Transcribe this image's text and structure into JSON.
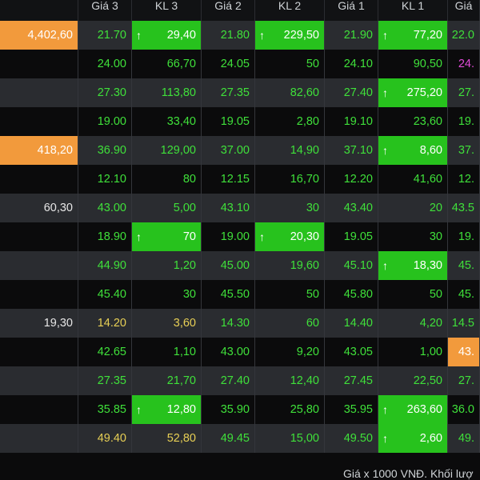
{
  "header": [
    "",
    "Giá 3",
    "KL 3",
    "Giá 2",
    "KL 2",
    "Giá 1",
    "KL 1",
    "Giá"
  ],
  "rows": [
    [
      {
        "t": "4,402,60",
        "c": "orange-bg"
      },
      {
        "t": "21.70",
        "c": "green"
      },
      {
        "t": "29,40",
        "c": "green-bg",
        "up": true
      },
      {
        "t": "21.80",
        "c": "green"
      },
      {
        "t": "229,50",
        "c": "green-bg",
        "up": true
      },
      {
        "t": "21.90",
        "c": "green"
      },
      {
        "t": "77,20",
        "c": "green-bg",
        "up": true
      },
      {
        "t": "22.0",
        "c": "green"
      }
    ],
    [
      {
        "t": "",
        "c": "white"
      },
      {
        "t": "24.00",
        "c": "green"
      },
      {
        "t": "66,70",
        "c": "green"
      },
      {
        "t": "24.05",
        "c": "green"
      },
      {
        "t": "50",
        "c": "green"
      },
      {
        "t": "24.10",
        "c": "green"
      },
      {
        "t": "90,50",
        "c": "green"
      },
      {
        "t": "24.",
        "c": "pink"
      }
    ],
    [
      {
        "t": "",
        "c": "white"
      },
      {
        "t": "27.30",
        "c": "green"
      },
      {
        "t": "113,80",
        "c": "green"
      },
      {
        "t": "27.35",
        "c": "green"
      },
      {
        "t": "82,60",
        "c": "green"
      },
      {
        "t": "27.40",
        "c": "green"
      },
      {
        "t": "275,20",
        "c": "green-bg",
        "up": true
      },
      {
        "t": "27.",
        "c": "green"
      }
    ],
    [
      {
        "t": "",
        "c": "white"
      },
      {
        "t": "19.00",
        "c": "green"
      },
      {
        "t": "33,40",
        "c": "green"
      },
      {
        "t": "19.05",
        "c": "green"
      },
      {
        "t": "2,80",
        "c": "green"
      },
      {
        "t": "19.10",
        "c": "green"
      },
      {
        "t": "23,60",
        "c": "green"
      },
      {
        "t": "19.",
        "c": "green"
      }
    ],
    [
      {
        "t": "418,20",
        "c": "orange-bg"
      },
      {
        "t": "36.90",
        "c": "green"
      },
      {
        "t": "129,00",
        "c": "green"
      },
      {
        "t": "37.00",
        "c": "green"
      },
      {
        "t": "14,90",
        "c": "green"
      },
      {
        "t": "37.10",
        "c": "green"
      },
      {
        "t": "8,60",
        "c": "green-bg",
        "up": true
      },
      {
        "t": "37.",
        "c": "green"
      }
    ],
    [
      {
        "t": "",
        "c": "white"
      },
      {
        "t": "12.10",
        "c": "green"
      },
      {
        "t": "80",
        "c": "green"
      },
      {
        "t": "12.15",
        "c": "green"
      },
      {
        "t": "16,70",
        "c": "green"
      },
      {
        "t": "12.20",
        "c": "green"
      },
      {
        "t": "41,60",
        "c": "green"
      },
      {
        "t": "12.",
        "c": "green"
      }
    ],
    [
      {
        "t": "60,30",
        "c": "white"
      },
      {
        "t": "43.00",
        "c": "green"
      },
      {
        "t": "5,00",
        "c": "green"
      },
      {
        "t": "43.10",
        "c": "green"
      },
      {
        "t": "30",
        "c": "green"
      },
      {
        "t": "43.40",
        "c": "green"
      },
      {
        "t": "20",
        "c": "green"
      },
      {
        "t": "43.5",
        "c": "green"
      }
    ],
    [
      {
        "t": "",
        "c": "white"
      },
      {
        "t": "18.90",
        "c": "green"
      },
      {
        "t": "70",
        "c": "green-bg",
        "up": true
      },
      {
        "t": "19.00",
        "c": "green"
      },
      {
        "t": "20,30",
        "c": "green-bg",
        "up": true
      },
      {
        "t": "19.05",
        "c": "green"
      },
      {
        "t": "30",
        "c": "green"
      },
      {
        "t": "19.",
        "c": "green"
      }
    ],
    [
      {
        "t": "",
        "c": "white"
      },
      {
        "t": "44.90",
        "c": "green"
      },
      {
        "t": "1,20",
        "c": "green"
      },
      {
        "t": "45.00",
        "c": "green"
      },
      {
        "t": "19,60",
        "c": "green"
      },
      {
        "t": "45.10",
        "c": "green"
      },
      {
        "t": "18,30",
        "c": "green-bg",
        "up": true
      },
      {
        "t": "45.",
        "c": "green"
      }
    ],
    [
      {
        "t": "",
        "c": "white"
      },
      {
        "t": "45.40",
        "c": "green"
      },
      {
        "t": "30",
        "c": "green"
      },
      {
        "t": "45.50",
        "c": "green"
      },
      {
        "t": "50",
        "c": "green"
      },
      {
        "t": "45.80",
        "c": "green"
      },
      {
        "t": "50",
        "c": "green"
      },
      {
        "t": "45.",
        "c": "green"
      }
    ],
    [
      {
        "t": "19,30",
        "c": "white"
      },
      {
        "t": "14.20",
        "c": "yellow"
      },
      {
        "t": "3,60",
        "c": "yellow"
      },
      {
        "t": "14.30",
        "c": "green"
      },
      {
        "t": "60",
        "c": "green"
      },
      {
        "t": "14.40",
        "c": "green"
      },
      {
        "t": "4,20",
        "c": "green"
      },
      {
        "t": "14.5",
        "c": "green"
      }
    ],
    [
      {
        "t": "",
        "c": "white"
      },
      {
        "t": "42.65",
        "c": "green"
      },
      {
        "t": "1,10",
        "c": "green"
      },
      {
        "t": "43.00",
        "c": "green"
      },
      {
        "t": "9,20",
        "c": "green"
      },
      {
        "t": "43.05",
        "c": "green"
      },
      {
        "t": "1,00",
        "c": "green"
      },
      {
        "t": "43.",
        "c": "orange-bg"
      }
    ],
    [
      {
        "t": "",
        "c": "white"
      },
      {
        "t": "27.35",
        "c": "green"
      },
      {
        "t": "21,70",
        "c": "green"
      },
      {
        "t": "27.40",
        "c": "green"
      },
      {
        "t": "12,40",
        "c": "green"
      },
      {
        "t": "27.45",
        "c": "green"
      },
      {
        "t": "22,50",
        "c": "green"
      },
      {
        "t": "27.",
        "c": "green"
      }
    ],
    [
      {
        "t": "",
        "c": "white"
      },
      {
        "t": "35.85",
        "c": "green"
      },
      {
        "t": "12,80",
        "c": "green-bg",
        "up": true
      },
      {
        "t": "35.90",
        "c": "green"
      },
      {
        "t": "25,80",
        "c": "green"
      },
      {
        "t": "35.95",
        "c": "green"
      },
      {
        "t": "263,60",
        "c": "green-bg",
        "up": true
      },
      {
        "t": "36.0",
        "c": "green"
      }
    ],
    [
      {
        "t": "",
        "c": "white"
      },
      {
        "t": "49.40",
        "c": "yellow"
      },
      {
        "t": "52,80",
        "c": "yellow"
      },
      {
        "t": "49.45",
        "c": "green"
      },
      {
        "t": "15,00",
        "c": "green"
      },
      {
        "t": "49.50",
        "c": "green"
      },
      {
        "t": "2,60",
        "c": "green-bg",
        "up": true
      },
      {
        "t": "49.",
        "c": "green"
      }
    ]
  ],
  "footer": {
    "text": "Giá x 1000 VNĐ. Khối lượ"
  },
  "colors": {
    "green": "#3fe03a",
    "yellow": "#e7cf55",
    "orange": "#f29a3c",
    "green_bg": "#27c21d",
    "pink": "#e04bd8"
  },
  "icons": {
    "up_arrow": "arrow-up-icon"
  }
}
